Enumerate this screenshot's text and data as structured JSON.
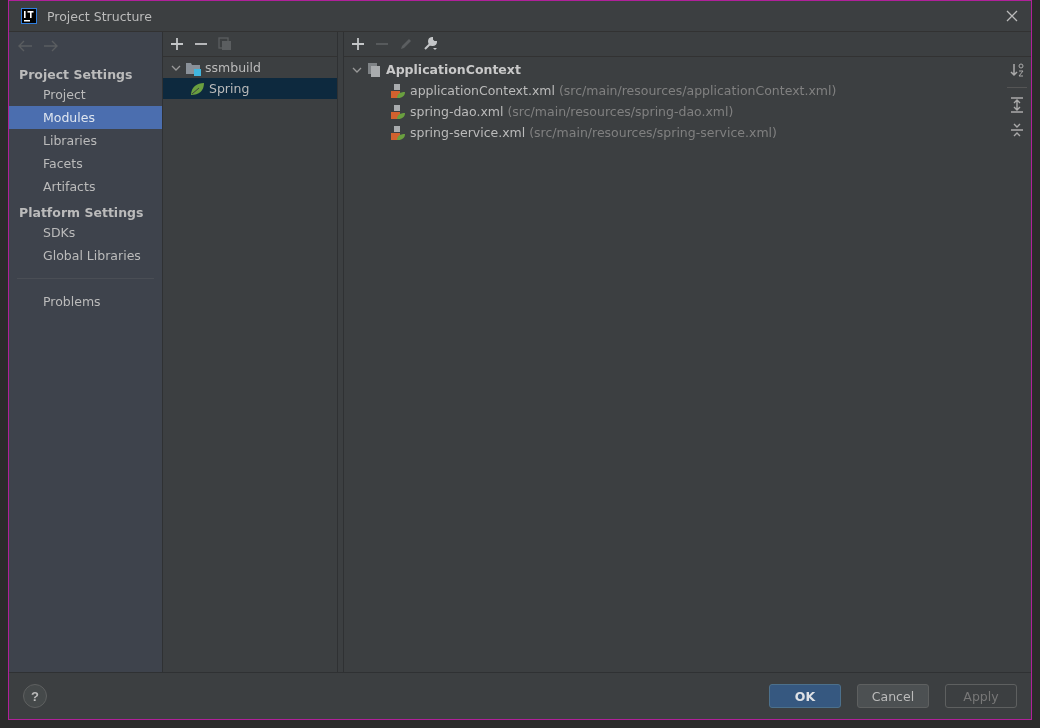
{
  "window": {
    "title": "Project Structure"
  },
  "navigation": [
    {
      "kind": "back",
      "disabled": true
    },
    {
      "kind": "forward",
      "disabled": true
    }
  ],
  "sidebar": {
    "sections": [
      {
        "title": "Project Settings",
        "items": [
          {
            "label": "Project",
            "selected": false
          },
          {
            "label": "Modules",
            "selected": true
          },
          {
            "label": "Libraries",
            "selected": false
          },
          {
            "label": "Facets",
            "selected": false
          },
          {
            "label": "Artifacts",
            "selected": false
          }
        ]
      },
      {
        "title": "Platform Settings",
        "items": [
          {
            "label": "SDKs",
            "selected": false
          },
          {
            "label": "Global Libraries",
            "selected": false
          }
        ]
      },
      {
        "items": [
          {
            "label": "Problems",
            "selected": false
          }
        ]
      }
    ]
  },
  "modules_toolbar": [
    {
      "kind": "add",
      "disabled": false
    },
    {
      "kind": "remove",
      "disabled": false
    },
    {
      "kind": "copy",
      "disabled": true
    }
  ],
  "module_tree": [
    {
      "label": "ssmbuild",
      "kind": "module",
      "expanded": true,
      "selected": false,
      "children": [
        {
          "label": "Spring",
          "kind": "spring",
          "selected": true
        }
      ]
    }
  ],
  "context_toolbar": [
    {
      "kind": "add",
      "disabled": false
    },
    {
      "kind": "remove",
      "disabled": true
    },
    {
      "kind": "edit",
      "disabled": true
    },
    {
      "kind": "wrench",
      "disabled": false
    }
  ],
  "context_tree": [
    {
      "label": "ApplicationContext",
      "expanded": true,
      "children": [
        {
          "name": "applicationContext.xml",
          "path": "(src/main/resources/applicationContext.xml)"
        },
        {
          "name": "spring-dao.xml",
          "path": "(src/main/resources/spring-dao.xml)"
        },
        {
          "name": "spring-service.xml",
          "path": "(src/main/resources/spring-service.xml)"
        }
      ]
    }
  ],
  "side_tools": [
    {
      "kind": "sort"
    },
    {
      "kind": "expand"
    },
    {
      "kind": "collapse"
    }
  ],
  "help": {
    "label": "?"
  },
  "buttons": [
    {
      "label": "OK",
      "default": true,
      "disabled": false
    },
    {
      "label": "Cancel",
      "default": false,
      "disabled": false
    },
    {
      "label": "Apply",
      "default": false,
      "disabled": true
    }
  ]
}
